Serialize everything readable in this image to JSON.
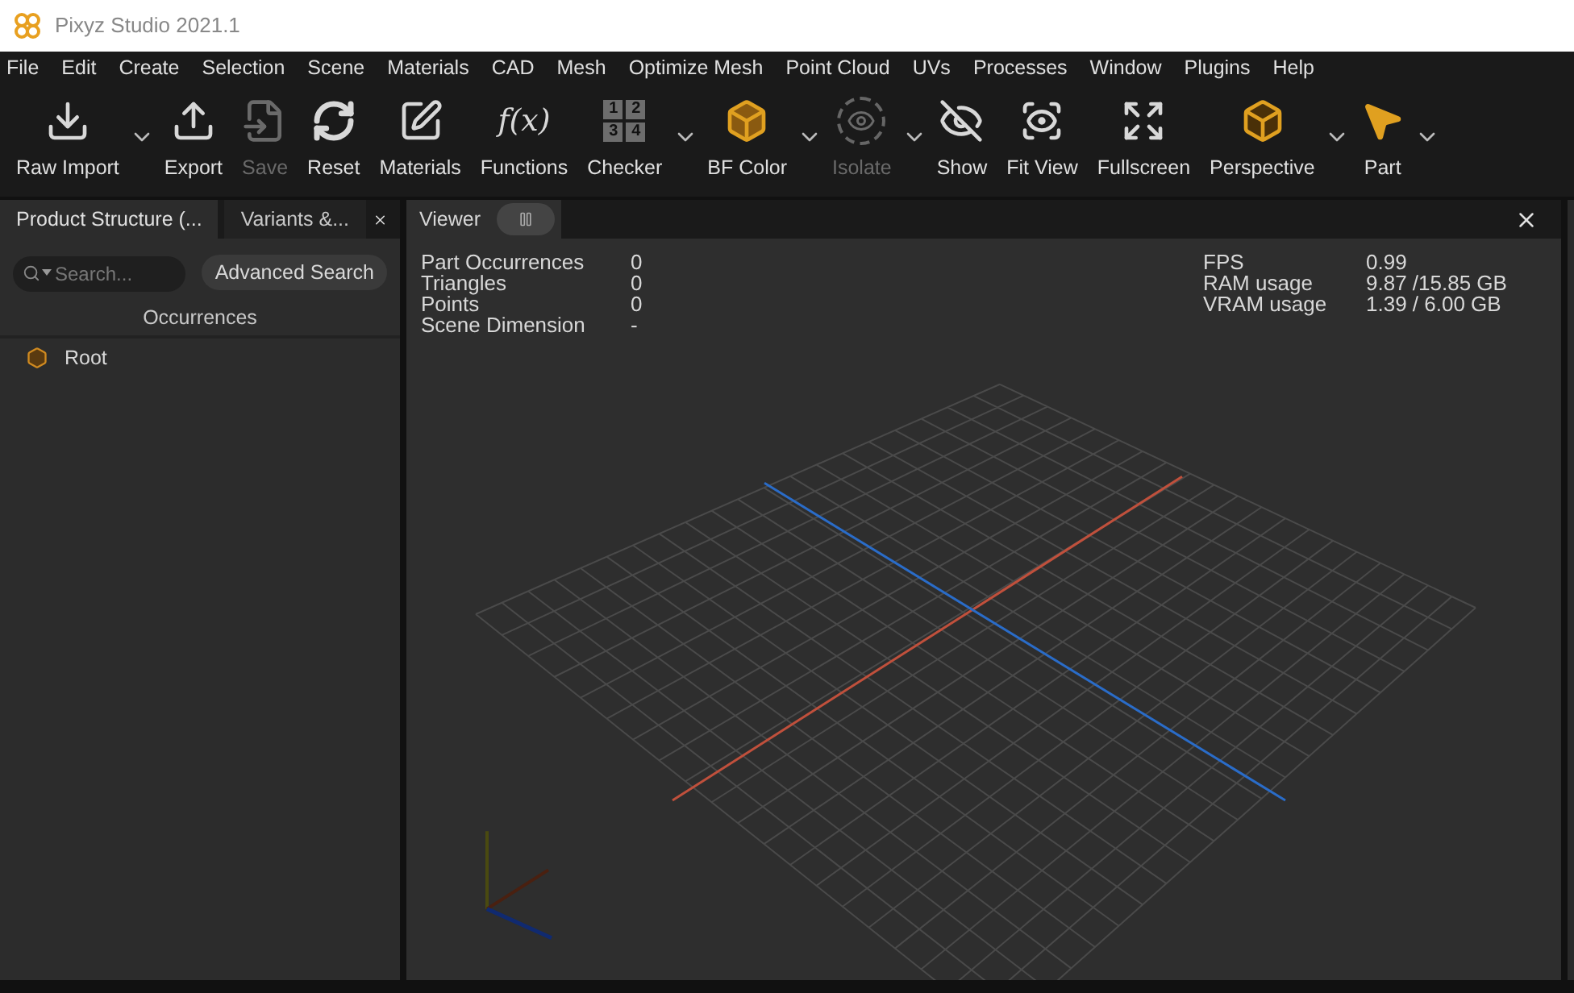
{
  "window": {
    "title": "Pixyz Studio 2021.1"
  },
  "menu": [
    "File",
    "Edit",
    "Create",
    "Selection",
    "Scene",
    "Materials",
    "CAD",
    "Mesh",
    "Optimize Mesh",
    "Point Cloud",
    "UVs",
    "Processes",
    "Window",
    "Plugins",
    "Help"
  ],
  "toolbar": [
    {
      "label": "Raw Import",
      "kind": "download",
      "disabled": false,
      "dropdown": true
    },
    {
      "label": "Export",
      "kind": "upload",
      "disabled": false,
      "dropdown": false
    },
    {
      "label": "Save",
      "kind": "save",
      "disabled": true,
      "dropdown": false
    },
    {
      "label": "Reset",
      "kind": "refresh",
      "disabled": false,
      "dropdown": false
    },
    {
      "label": "Materials",
      "kind": "pen",
      "disabled": false,
      "dropdown": false
    },
    {
      "label": "Functions",
      "kind": "fx",
      "icon_text": "f(x)",
      "disabled": false,
      "dropdown": false
    },
    {
      "label": "Checker",
      "kind": "checker",
      "icon_digits": [
        "1",
        "2",
        "3",
        "4"
      ],
      "disabled": false,
      "dropdown": true
    },
    {
      "label": "BF Color",
      "kind": "cube",
      "disabled": false,
      "dropdown": true
    },
    {
      "label": "Isolate",
      "kind": "isolate",
      "disabled": true,
      "dropdown": true
    },
    {
      "label": "Show",
      "kind": "hide",
      "disabled": false,
      "dropdown": false
    },
    {
      "label": "Fit View",
      "kind": "fit",
      "disabled": false,
      "dropdown": false
    },
    {
      "label": "Fullscreen",
      "kind": "expand",
      "disabled": false,
      "dropdown": false
    },
    {
      "label": "Perspective",
      "kind": "dice",
      "disabled": false,
      "dropdown": true
    },
    {
      "label": "Part",
      "kind": "part",
      "disabled": false,
      "dropdown": true
    }
  ],
  "left_panel": {
    "tabs": [
      {
        "label": "Product Structure (...",
        "selected": true
      },
      {
        "label": "Variants &...",
        "selected": false
      }
    ],
    "search": {
      "placeholder": "Search..."
    },
    "advanced_search": "Advanced Search",
    "header": "Occurrences",
    "tree": [
      {
        "label": "Root"
      }
    ]
  },
  "viewer": {
    "tab": "Viewer",
    "stats_left": [
      {
        "name": "Part Occurrences",
        "value": "0"
      },
      {
        "name": "Triangles",
        "value": "0"
      },
      {
        "name": "Points",
        "value": "0"
      },
      {
        "name": "Scene Dimension",
        "value": "-"
      }
    ],
    "stats_right": [
      {
        "name": "FPS",
        "value": "0.99"
      },
      {
        "name": "RAM usage",
        "value": "9.87 /15.85 GB"
      },
      {
        "name": "VRAM usage",
        "value": "1.39 / 6.00 GB"
      }
    ]
  }
}
